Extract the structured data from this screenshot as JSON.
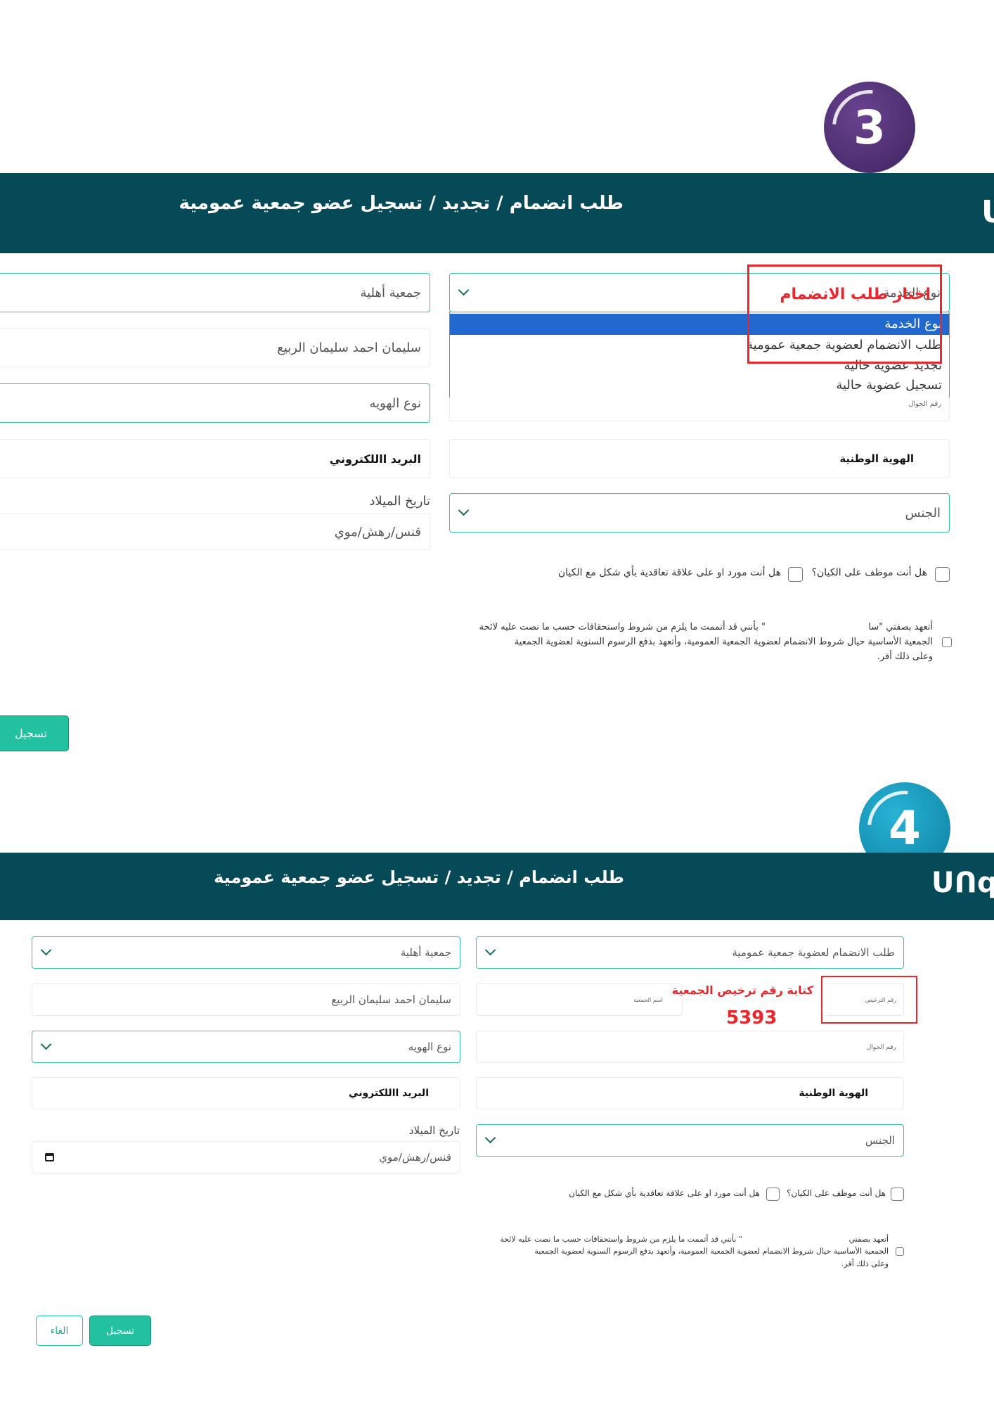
{
  "panel1": {
    "step_number": "3",
    "header_title": "طلب انضمام / تجديد / تسجيل عضو جمعية عمومية",
    "logo_fragment": "U",
    "association_type_value": "جمعية أهلية",
    "member_name_value": "سليمان احمد سليمان الربيع",
    "id_type_value": "نوع الهويه",
    "email_label": "البريد االلكتروني",
    "dob_label": "تاريخ الميلاد",
    "dob_placeholder": "قنس/رهش/موي",
    "service_select_value": "نوع الخدمة",
    "dropdown_options": [
      "نوع الخدمة",
      "طلب الانضمام لعضوية جمعية عمومية",
      "تجديد عضوية حاليه",
      "تسجيل عضوية حالية"
    ],
    "mobile_small_label": "رقم الجوال",
    "national_id_label": "الهوية الوطنية",
    "gender_value": "الجنس",
    "q_employee": "هل أنت موظف على الكيان؟",
    "q_supplier": "هل أنت مورد او على علاقة تعاقدية بأي شكل مع الكيان",
    "pledge_line1_right": "أتعهد بصفتي \"سا",
    "pledge_line1_left": "\" بأنني قد أتممت ما يلزم من شروط واستحقاقات حسب ما نصت عليه لائحة",
    "pledge_line2": "الجمعية الأساسية حيال شروط الانضمام لعضوية الجمعية العمومية، وأتعهد بدفع الرسوم السنوية لعضوية الجمعية",
    "pledge_line3": "وعلى ذلك أقر.",
    "register_button": "تسجيل",
    "annotation": "اختار طلب الانضمام"
  },
  "panel2": {
    "step_number": "4",
    "header_title": "طلب انضمام / تجديد / تسجيل عضو جمعية عمومية",
    "logo_fragment": "ᑌᑎqᑌ",
    "association_type_value": "جمعية أهلية",
    "member_name_value": "سليمان احمد سليمان الربيع",
    "id_type_value": "نوع الهويه",
    "email_label": "البريد االلكتروني",
    "dob_label": "تاريخ الميلاد",
    "dob_placeholder": "قنس/رهش/موي",
    "service_select_value": "طلب الانضمام لعضوية جمعية عمومية",
    "license_small_label": "رقم الترخيص",
    "assoc_name_small_label": "اسم الجمعية",
    "mobile_small_label": "رقم الجوال",
    "national_id_label": "الهوية الوطنية",
    "gender_value": "الجنس",
    "q_employee": "هل أنت موظف على الكيان؟",
    "q_supplier": "هل أنت مورد او على علاقة تعاقدية بأي شكل مع الكيان",
    "pledge_line1_right": "أتعهد بصفتي",
    "pledge_line1_left": "\" بأنني قد أتممت ما يلزم من شروط واستحقاقات حسب ما نصت عليه لائحة",
    "pledge_line2": "الجمعية الأساسية حيال شروط الانضمام لعضوية الجمعية العمومية، وأتعهد بدفع الرسوم السنوية لعضوية الجمعية",
    "pledge_line3": "وعلى ذلك أقر.",
    "register_button": "تسجيل",
    "cancel_button": "الغاء",
    "annotation": "كتابة رقم ترخيص الجمعية",
    "license_number": "5393"
  },
  "colors": {
    "header_bg": "#064a57",
    "accent": "#22c2a0",
    "annotation": "#e8262b",
    "badge3": "#4e2d72",
    "badge4": "#1591b4",
    "dropdown_selected": "#2169cf"
  }
}
